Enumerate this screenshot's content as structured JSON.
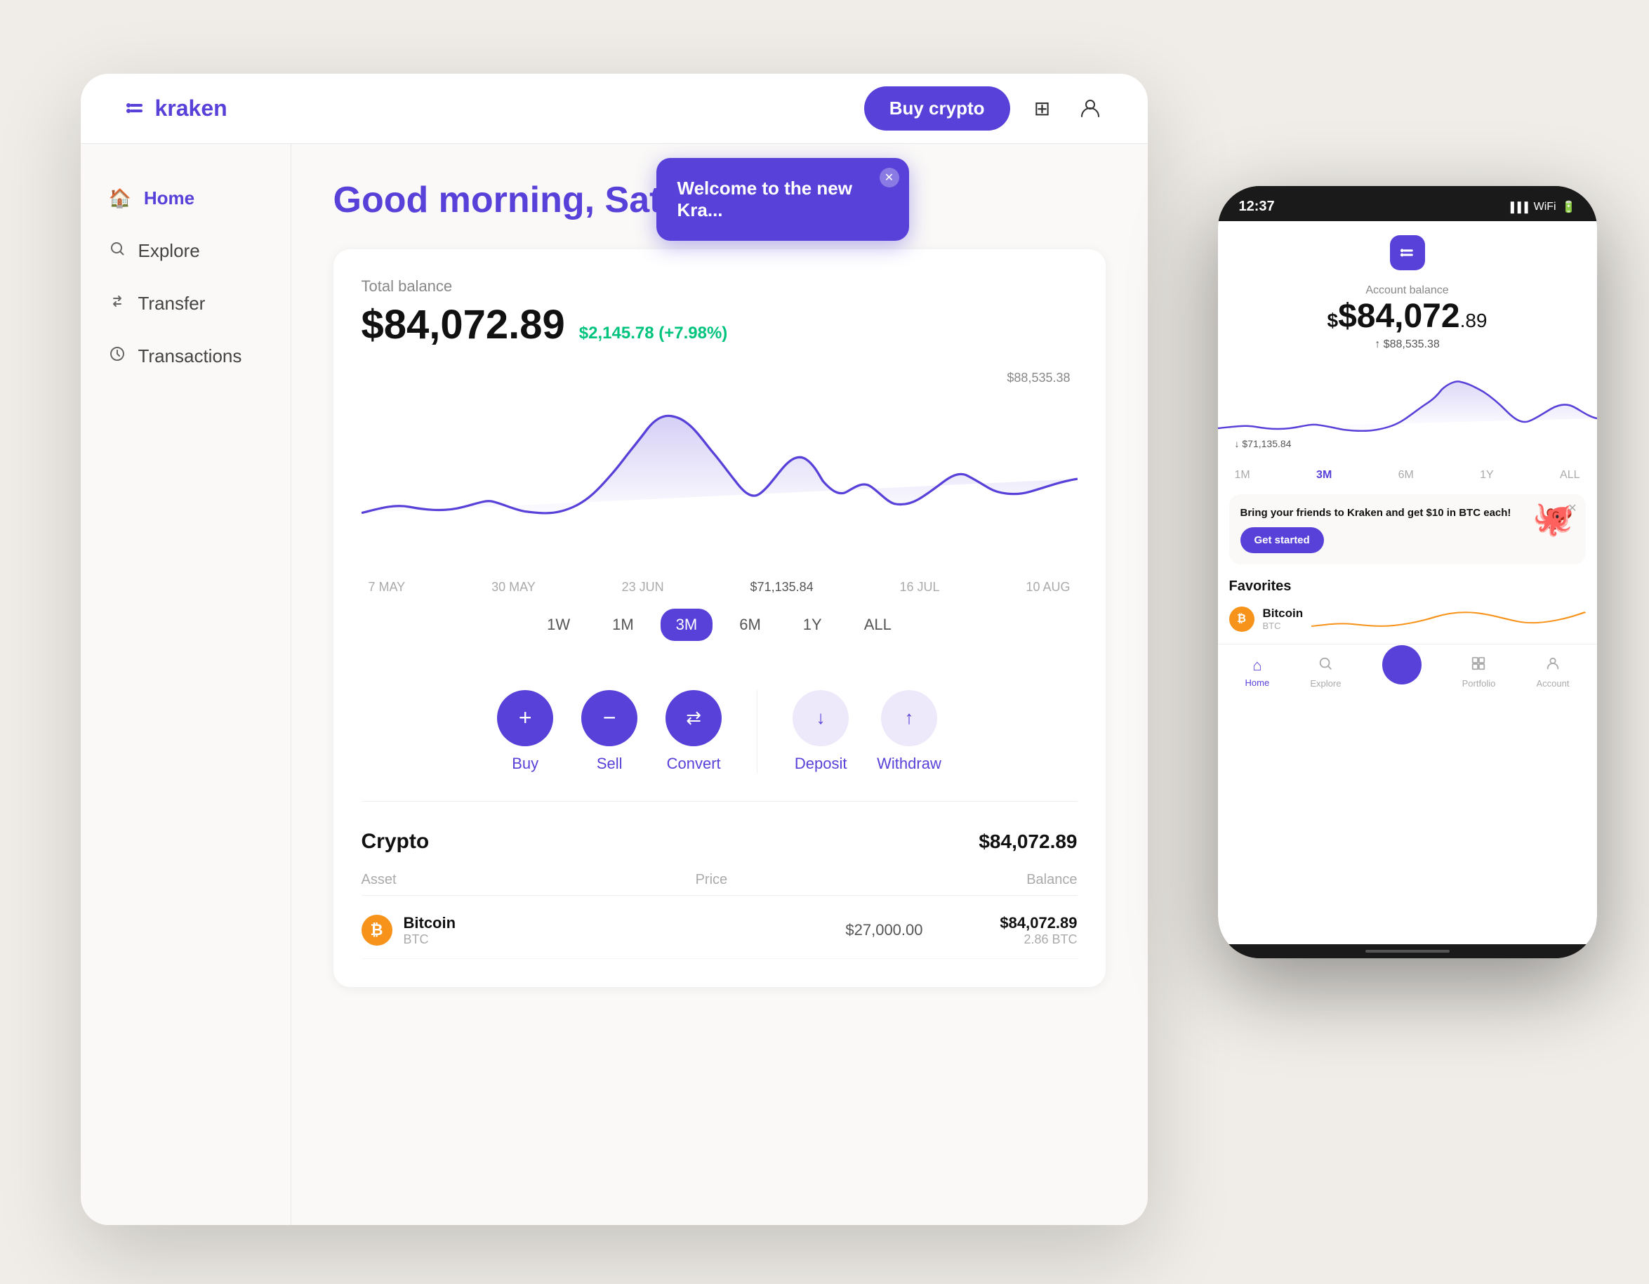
{
  "app": {
    "logo_text": "kraken",
    "buy_crypto_label": "Buy crypto"
  },
  "topbar": {
    "grid_icon": "⊞",
    "user_icon": "👤"
  },
  "sidebar": {
    "items": [
      {
        "id": "home",
        "label": "Home",
        "icon": "🏠",
        "active": true
      },
      {
        "id": "explore",
        "label": "Explore",
        "icon": "🔍",
        "active": false
      },
      {
        "id": "transfer",
        "label": "Transfer",
        "icon": "↔",
        "active": false
      },
      {
        "id": "transactions",
        "label": "Transactions",
        "icon": "🕐",
        "active": false
      }
    ]
  },
  "main": {
    "greeting": "Good morning, Satoshi",
    "balance": {
      "label": "Total balance",
      "amount": "$84,072.89",
      "change": "$2,145.78 (+7.98%)"
    },
    "chart": {
      "high_label": "$88,535.38",
      "x_labels": [
        "7 MAY",
        "30 MAY",
        "23 JUN",
        "16 JUL",
        "10 AUG"
      ],
      "mid_label": "$71,135.84"
    },
    "time_filters": [
      {
        "label": "1W",
        "active": false
      },
      {
        "label": "1M",
        "active": false
      },
      {
        "label": "3M",
        "active": true
      },
      {
        "label": "6M",
        "active": false
      },
      {
        "label": "1Y",
        "active": false
      },
      {
        "label": "ALL",
        "active": false
      }
    ],
    "actions": [
      {
        "id": "buy",
        "label": "Buy",
        "icon": "+",
        "style": "solid"
      },
      {
        "id": "sell",
        "label": "Sell",
        "icon": "−",
        "style": "solid"
      },
      {
        "id": "convert",
        "label": "Convert",
        "icon": "⇄",
        "style": "solid"
      },
      {
        "id": "deposit",
        "label": "Deposit",
        "icon": "↓",
        "style": "light"
      },
      {
        "id": "withdraw",
        "label": "Withdraw",
        "icon": "↑",
        "style": "light"
      }
    ],
    "crypto": {
      "title": "Crypto",
      "total": "$84,072.89",
      "table_headers": [
        "Asset",
        "Price",
        "Balance"
      ],
      "rows": [
        {
          "name": "Bitcoin",
          "ticker": "BTC",
          "price": "$27,000.00",
          "balance": "$84,072.89",
          "sub_balance": "2.86 BTC"
        }
      ]
    }
  },
  "welcome_banner": {
    "title": "Welcome to the new Kra..."
  },
  "phone": {
    "time": "12:37",
    "balance_label": "Account balance",
    "balance_main": "$84,072",
    "balance_decimal": ".89",
    "balance_high": "↑ $88,535.38",
    "balance_low": "↓ $71,135.84",
    "time_filters": [
      "1M",
      "3M",
      "6M",
      "1Y",
      "ALL"
    ],
    "active_filter": "3M",
    "referral_text": "Bring your friends to Kraken and get $10 in BTC each!",
    "referral_cta": "Get started",
    "favorites_title": "Favorites",
    "fav_asset_name": "Bitcoin",
    "fav_asset_ticker": "BTC",
    "nav_items": [
      {
        "id": "home",
        "label": "Home",
        "icon": "⌂",
        "active": true
      },
      {
        "id": "explore",
        "label": "Explore",
        "icon": "⊕",
        "active": false
      },
      {
        "id": "convert",
        "label": "",
        "icon": "⇄",
        "active": false,
        "center": true
      },
      {
        "id": "portfolio",
        "label": "Portfolio",
        "icon": "▦",
        "active": false
      },
      {
        "id": "account",
        "label": "Account",
        "icon": "👤",
        "active": false
      }
    ]
  }
}
